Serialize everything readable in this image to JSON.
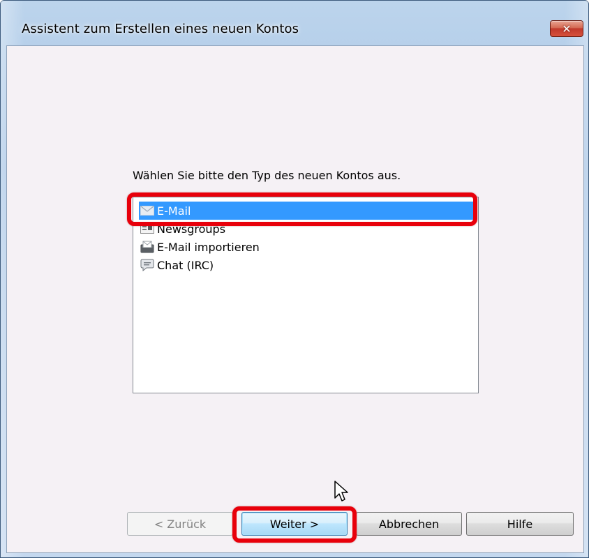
{
  "window": {
    "title": "Assistent zum Erstellen eines neuen Kontos",
    "close_glyph": "✕"
  },
  "main": {
    "prompt": "Wählen Sie bitte den Typ des neuen Kontos aus.",
    "account_types": [
      {
        "label": "E-Mail",
        "icon": "envelope-icon",
        "selected": true
      },
      {
        "label": "Newsgroups",
        "icon": "newsgroups-icon",
        "selected": false
      },
      {
        "label": "E-Mail importieren",
        "icon": "import-mail-icon",
        "selected": false
      },
      {
        "label": "Chat (IRC)",
        "icon": "chat-bubble-icon",
        "selected": false
      }
    ]
  },
  "buttons": {
    "back": "< Zurück",
    "next": "Weiter >",
    "cancel": "Abbrechen",
    "help": "Hilfe"
  },
  "colors": {
    "selection": "#3399ff",
    "annotation_highlight": "#e8000b",
    "client_background": "#f5f1f5"
  }
}
